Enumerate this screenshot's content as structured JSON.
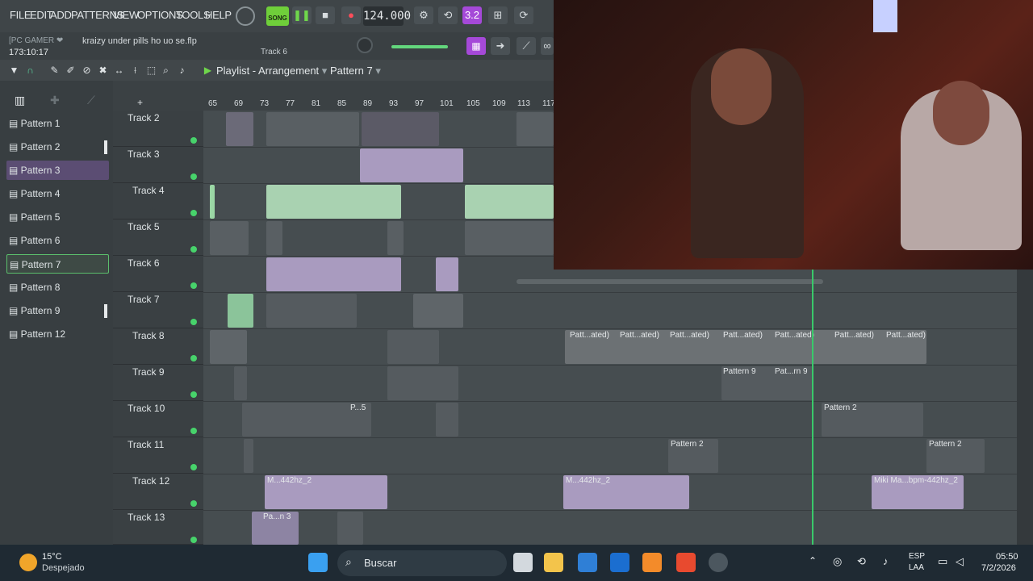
{
  "menu": {
    "file": "FILE",
    "edit": "EDIT",
    "add": "ADD",
    "patterns": "PATTERNS",
    "view": "VIEW",
    "options": "OPTIONS",
    "tools": "TOOLS",
    "help": "HELP"
  },
  "transport": {
    "song_mode": "SONG",
    "tempo": "124.000",
    "time_display": "173:10:17"
  },
  "hint": {
    "user": "[PC GAMER ❤",
    "project_file": "kraizy under pills ho uo se.flp",
    "track": "Track 6"
  },
  "playlist": {
    "title": "Playlist - Arrangement",
    "pattern": "Pattern 7"
  },
  "patterns": [
    {
      "label": "Pattern 1"
    },
    {
      "label": "Pattern 2"
    },
    {
      "label": "Pattern 3"
    },
    {
      "label": "Pattern 4"
    },
    {
      "label": "Pattern 5"
    },
    {
      "label": "Pattern 6"
    },
    {
      "label": "Pattern 7"
    },
    {
      "label": "Pattern 8"
    },
    {
      "label": "Pattern 9"
    },
    {
      "label": "Pattern 12"
    }
  ],
  "ruler": [
    "65",
    "69",
    "73",
    "77",
    "81",
    "85",
    "89",
    "93",
    "97",
    "101",
    "105",
    "109",
    "113",
    "117"
  ],
  "tracks": [
    "Track 2",
    "Track 3",
    "Track 4",
    "Track 5",
    "Track 6",
    "Track 7",
    "Track 8",
    "Track 9",
    "Track 10",
    "Track 11",
    "Track 12",
    "Track 13"
  ],
  "clips": {
    "patt_ated": "Patt...ated)",
    "pattern9": "Pattern 9",
    "patrn9": "Pat...rn 9",
    "pattern2": "Pattern 2",
    "p5": "P...5",
    "m442a": "M...442hz_2",
    "m442b": "M...442hz_2",
    "miki": "Miki Ma...bpm-442hz_2",
    "pan3": "Pa...n 3"
  },
  "taskbar": {
    "temp": "15°C",
    "weather": "Despejado",
    "search": "Buscar",
    "lang1": "ESP",
    "lang2": "LAA",
    "time": "05:50",
    "date": "7/2/2026"
  }
}
